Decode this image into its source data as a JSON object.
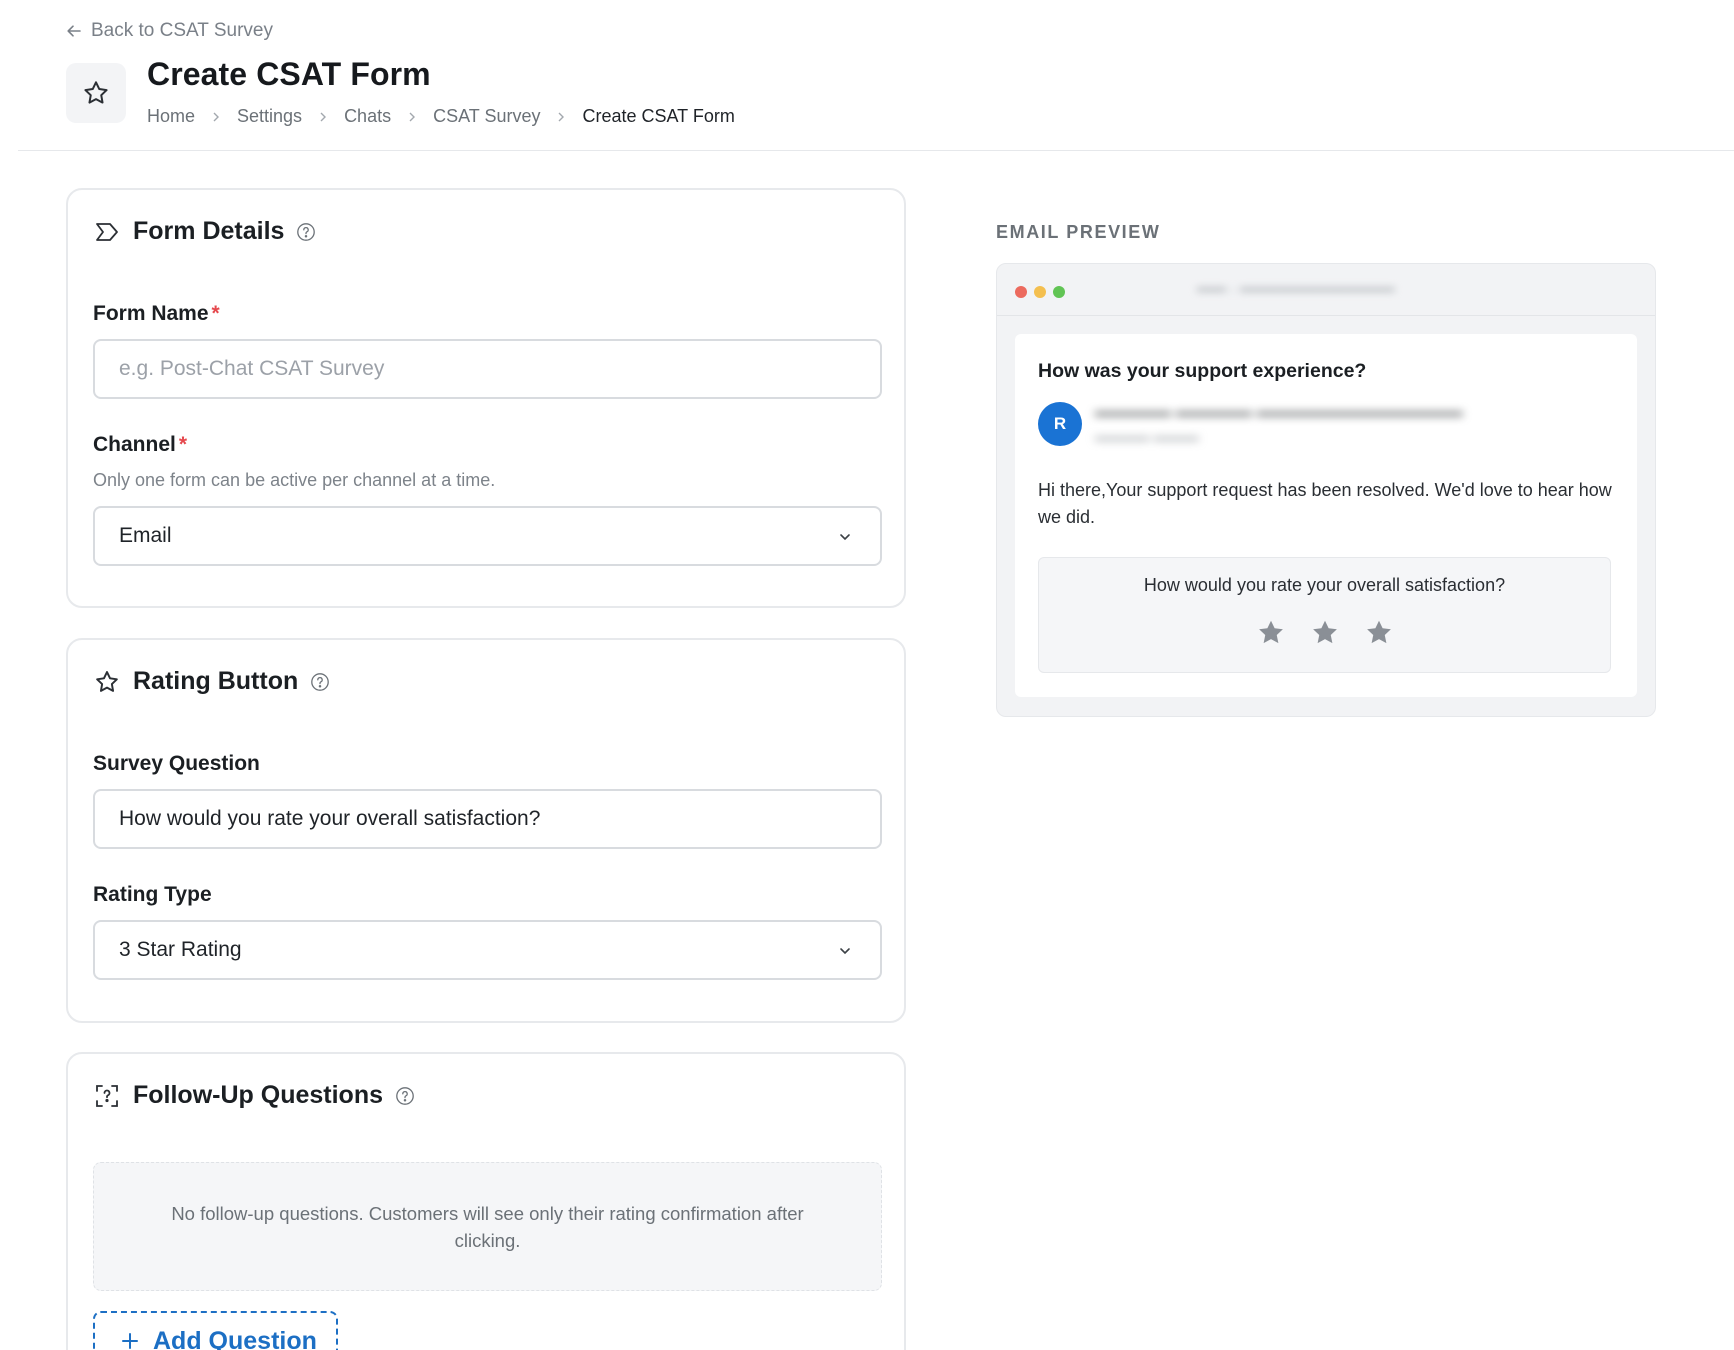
{
  "header": {
    "back_label": "Back to CSAT Survey",
    "title": "Create CSAT Form",
    "breadcrumb": [
      "Home",
      "Settings",
      "Chats",
      "CSAT Survey",
      "Create CSAT Form"
    ]
  },
  "form_details": {
    "title": "Form Details",
    "form_name_label": "Form Name",
    "form_name_placeholder": "e.g. Post-Chat CSAT Survey",
    "form_name_value": "",
    "channel_label": "Channel",
    "channel_hint": "Only one form can be active per channel at a time.",
    "channel_value": "Email",
    "required_marker": "*"
  },
  "rating_button": {
    "title": "Rating Button",
    "question_label": "Survey Question",
    "question_value": "How would you rate your overall satisfaction?",
    "rating_type_label": "Rating Type",
    "rating_type_value": "3 Star Rating"
  },
  "follow_up": {
    "title": "Follow-Up Questions",
    "empty_text": "No follow-up questions. Customers will see only their rating confirmation after clicking.",
    "add_label": "Add Question"
  },
  "preview": {
    "label": "EMAIL PREVIEW",
    "subject": "How was your support experience?",
    "avatar_letter": "R",
    "body_text": "Hi there,Your support request has been resolved. We'd love to hear how we did.",
    "rating_question": "How would you rate your overall satisfaction?",
    "star_count": 3,
    "star_color": "#8a8f96"
  },
  "colors": {
    "accent": "#1c6fc4",
    "required": "#e5484d",
    "avatar": "#1a73d4"
  }
}
